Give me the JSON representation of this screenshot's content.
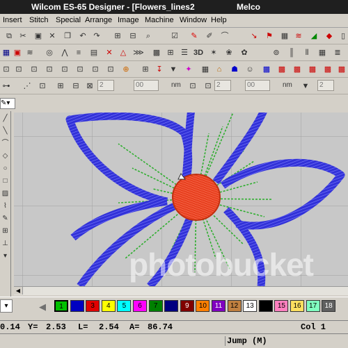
{
  "window": {
    "title": "Wilcom ES-65 Designer - [Flowers_lines2",
    "vendor": "Melco"
  },
  "menu": [
    "Insert",
    "Stitch",
    "Special",
    "Arrange",
    "Image",
    "Machine",
    "Window",
    "Help"
  ],
  "toolbar": {
    "row1_icons": [
      "undo-icon",
      "redo-icon",
      "grid-icon",
      "align-icon",
      "zoom-icon",
      "check-icon",
      "feather-icon",
      "pen-icon",
      "curve-icon",
      "needle-icon",
      "spool-icon",
      "zigzag-icon",
      "chart-icon",
      "palette-icon"
    ],
    "row2_icons": [
      "grid-icon",
      "cube-icon",
      "cross-icon",
      "stitch-icon",
      "zigzag-icon",
      "triangle-icon",
      "wave-icon",
      "grid-icon",
      "lines-icon",
      "3d-icon",
      "star-icon",
      "flower-icon"
    ],
    "row2_label": "3D",
    "row3_icons": [
      "people-icon",
      "people-icon",
      "people-icon",
      "people-icon",
      "people-icon",
      "sequence-icon",
      "arrow-icon",
      "arrow-icon",
      "arrow-icon",
      "grid-icon",
      "star-icon",
      "house-icon",
      "people-icon",
      "people-icon"
    ],
    "row4_units": [
      "nm",
      "nm",
      "nm"
    ],
    "row4_values": [
      "2",
      "00",
      "2",
      "00",
      "2"
    ]
  },
  "canvas": {
    "watermark": "photobucket"
  },
  "palette": {
    "colors": [
      {
        "label": "1",
        "color": "#00c000"
      },
      {
        "label": "",
        "color": "#0000c0"
      },
      {
        "label": "3",
        "color": "#e00000"
      },
      {
        "label": "4",
        "color": "#ffff00"
      },
      {
        "label": "5",
        "color": "#00ffff"
      },
      {
        "label": "6",
        "color": "#ff00ff"
      },
      {
        "label": "7",
        "color": "#008000"
      },
      {
        "label": "",
        "color": "#000080"
      },
      {
        "label": "9",
        "color": "#800000"
      },
      {
        "label": "10",
        "color": "#ff8000"
      },
      {
        "label": "11",
        "color": "#8000c0"
      },
      {
        "label": "12",
        "color": "#c08040"
      },
      {
        "label": "13",
        "color": "#ffffff"
      },
      {
        "label": "",
        "color": "#000000"
      },
      {
        "label": "15",
        "color": "#ff80c0"
      },
      {
        "label": "16",
        "color": "#ffe060"
      },
      {
        "label": "17",
        "color": "#80ffc0"
      },
      {
        "label": "18",
        "color": "#606060"
      }
    ]
  },
  "status": {
    "x": "0.14",
    "y_label": "Y=",
    "y": "2.53",
    "l_label": "L=",
    "l": "2.54",
    "a_label": "A=",
    "a": "86.74",
    "color": "Col 1",
    "mode": "Jump (M)"
  }
}
